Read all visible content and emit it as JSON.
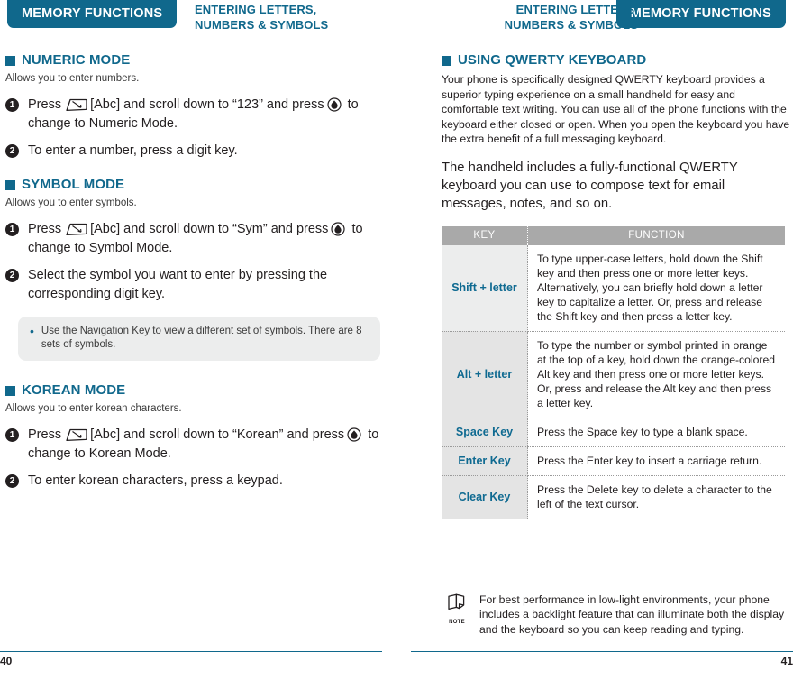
{
  "left_page": {
    "tab_label": "MEMORY FUNCTIONS",
    "chapter_title": "ENTERING LETTERS,\nNUMBERS & SYMBOLS",
    "chapter_line1": "ENTERING LETTERS,",
    "chapter_line2": "NUMBERS & SYMBOLS",
    "page_number": "40",
    "sections": [
      {
        "heading": "NUMERIC MODE",
        "lead": "Allows you to enter numbers.",
        "steps": [
          {
            "number": "1",
            "part1": "Press",
            "icon1": "softkey-icon",
            "part2": "[Abc] and scroll down to “123” and press",
            "icon2": "ok-key-icon",
            "part3": "to change to Numeric Mode."
          },
          {
            "number": "2",
            "text": "To enter a number, press a digit key."
          }
        ]
      },
      {
        "heading": "SYMBOL MODE",
        "lead": "Allows you to enter symbols.",
        "steps": [
          {
            "number": "1",
            "part1": "Press",
            "icon1": "softkey-icon",
            "part2": "[Abc] and scroll down to “Sym” and press",
            "icon2": "ok-key-icon",
            "part3": "to change to Symbol Mode."
          },
          {
            "number": "2",
            "text": "Select the symbol you want to enter by pressing the corresponding digit key."
          }
        ],
        "note": "Use the Navigation Key to view a different set of symbols. There are 8 sets of symbols."
      },
      {
        "heading": "KOREAN MODE",
        "lead": "Allows you to enter korean characters.",
        "steps": [
          {
            "number": "1",
            "part1": "Press",
            "icon1": "softkey-icon",
            "part2": "[Abc] and scroll down to “Korean” and press",
            "icon2": "ok-key-icon",
            "part3": "to change to Korean Mode."
          },
          {
            "number": "2",
            "text": "To enter korean characters, press a keypad."
          }
        ]
      }
    ]
  },
  "right_page": {
    "tab_label": "MEMORY FUNCTIONS",
    "chapter_line1": "ENTERING LETTERS,",
    "chapter_line2": "NUMBERS & SYMBOLS",
    "page_number": "41",
    "heading": "USING QWERTY KEYBOARD",
    "paragraph_1": "Your phone is specifically designed QWERTY keyboard provides a superior typing experience on a small handheld for easy and comfortable text writing. You can use all of the phone functions with the keyboard either closed or open. When you open the keyboard you have the extra benefit of a full messaging keyboard.",
    "paragraph_2": "The handheld includes a fully-functional QWERTY keyboard you can use to compose text for email messages, notes, and so on.",
    "table": {
      "columns": [
        "KEY",
        "FUNCTION"
      ],
      "rows": [
        {
          "key": "Shift + letter",
          "function": "To type upper-case letters, hold down the Shift key and then press one or more letter keys. Alternatively, you can briefly hold down a letter key to capitalize a letter. Or, press and release the Shift key and then press a letter key."
        },
        {
          "key": "Alt + letter",
          "function": "To type the number or symbol printed in orange at the top of a key, hold down the orange-colored Alt key and then press one or more letter keys. Or, press and release the Alt key and then press a letter key."
        },
        {
          "key": "Space Key",
          "function": "Press the Space key to type a blank space."
        },
        {
          "key": "Enter Key",
          "function": "Press the Enter key to insert a carriage return."
        },
        {
          "key": "Clear Key",
          "function": "Press the Delete key to delete a character to the left of the text cursor."
        }
      ]
    },
    "note": {
      "icon_label": "NOTE",
      "text": "For best performance in low-light environments, your phone includes a backlight feature that can illuminate both the display and the keyboard so you can keep reading and typing."
    }
  },
  "colors": {
    "brand_teal": "#10688c",
    "key_label_blue": "#0f6a91",
    "table_header_gray": "#a9a9a9",
    "note_box_gray": "#eceded",
    "row_shade_gray": "#e4e4e4",
    "text_black": "#231f20"
  }
}
